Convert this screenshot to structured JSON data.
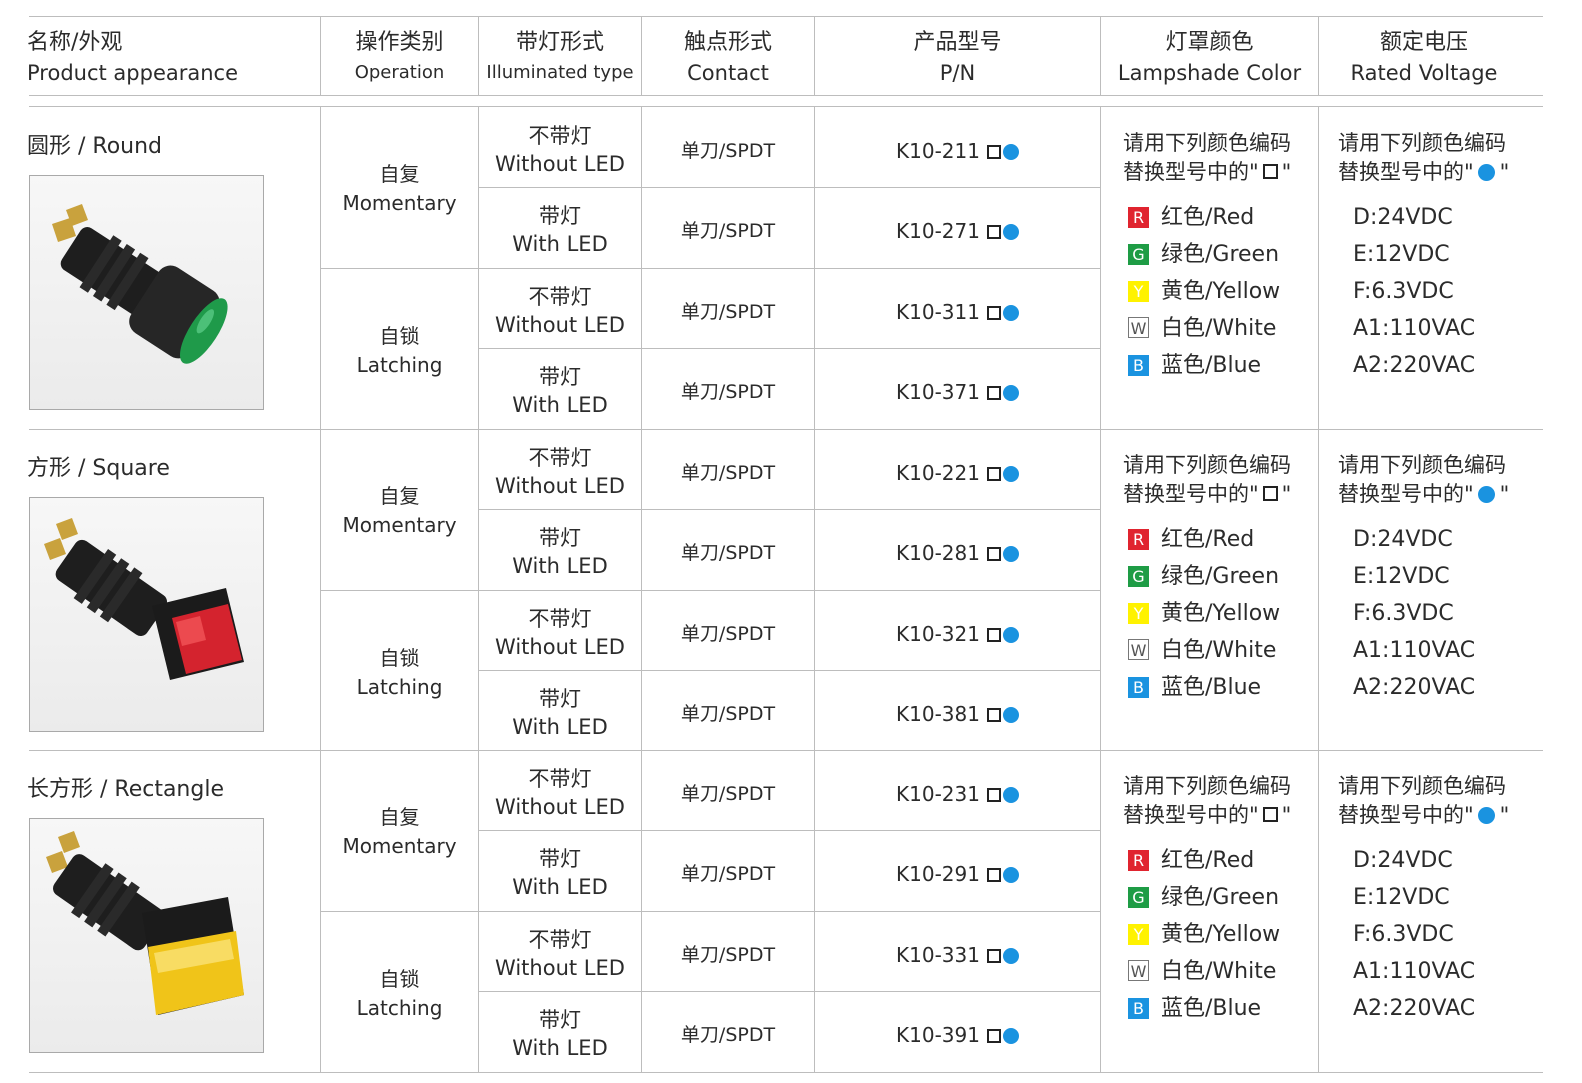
{
  "header": {
    "appearance_cn": "名称/外观",
    "appearance_en": "Product appearance",
    "operation_cn": "操作类别",
    "operation_en": "Operation",
    "illum_cn": "带灯形式",
    "illum_en": "Illuminated type",
    "contact_cn": "触点形式",
    "contact_en": "Contact",
    "pn_cn": "产品型号",
    "pn_en": "P/N",
    "color_cn": "灯罩颜色",
    "color_en": "Lampshade Color",
    "voltage_cn": "额定电压",
    "voltage_en": "Rated Voltage"
  },
  "groups": [
    {
      "shape": "圆形 / Round",
      "photo_icon": "round-green-pushbutton",
      "lens_color": "#1f9a4a",
      "ops": [
        {
          "cn": "自复",
          "en": "Momentary"
        },
        {
          "cn": "自锁",
          "en": "Latching"
        }
      ],
      "rows": [
        {
          "illum_cn": "不带灯",
          "illum_en": "Without LED",
          "contact": "单刀/SPDT",
          "pn": "K10-211"
        },
        {
          "illum_cn": "带灯",
          "illum_en": "With LED",
          "contact": "单刀/SPDT",
          "pn": "K10-271"
        },
        {
          "illum_cn": "不带灯",
          "illum_en": "Without LED",
          "contact": "单刀/SPDT",
          "pn": "K10-311"
        },
        {
          "illum_cn": "带灯",
          "illum_en": "With LED",
          "contact": "单刀/SPDT",
          "pn": "K10-371"
        }
      ]
    },
    {
      "shape": "方形 / Square",
      "photo_icon": "square-red-pushbutton",
      "lens_color": "#d4232e",
      "ops": [
        {
          "cn": "自复",
          "en": "Momentary"
        },
        {
          "cn": "自锁",
          "en": "Latching"
        }
      ],
      "rows": [
        {
          "illum_cn": "不带灯",
          "illum_en": "Without LED",
          "contact": "单刀/SPDT",
          "pn": "K10-221"
        },
        {
          "illum_cn": "带灯",
          "illum_en": "With LED",
          "contact": "单刀/SPDT",
          "pn": "K10-281"
        },
        {
          "illum_cn": "不带灯",
          "illum_en": "Without LED",
          "contact": "单刀/SPDT",
          "pn": "K10-321"
        },
        {
          "illum_cn": "带灯",
          "illum_en": "With LED",
          "contact": "单刀/SPDT",
          "pn": "K10-381"
        }
      ]
    },
    {
      "shape": "长方形 / Rectangle",
      "photo_icon": "rectangle-yellow-pushbutton",
      "lens_color": "#f0c419",
      "ops": [
        {
          "cn": "自复",
          "en": "Momentary"
        },
        {
          "cn": "自锁",
          "en": "Latching"
        }
      ],
      "rows": [
        {
          "illum_cn": "不带灯",
          "illum_en": "Without LED",
          "contact": "单刀/SPDT",
          "pn": "K10-231"
        },
        {
          "illum_cn": "带灯",
          "illum_en": "With LED",
          "contact": "单刀/SPDT",
          "pn": "K10-291"
        },
        {
          "illum_cn": "不带灯",
          "illum_en": "Without LED",
          "contact": "单刀/SPDT",
          "pn": "K10-331"
        },
        {
          "illum_cn": "带灯",
          "illum_en": "With LED",
          "contact": "单刀/SPDT",
          "pn": "K10-391"
        }
      ]
    }
  ],
  "color_note": {
    "line1": "请用下列颜色编码",
    "line2_prefix": "替换型号中的\"",
    "line2_suffix": "\""
  },
  "voltage_note": {
    "line1": "请用下列颜色编码",
    "line2_prefix": "替换型号中的\"",
    "line2_suffix": "\""
  },
  "colors": [
    {
      "code": "R",
      "label": "红色/Red",
      "badge_bg": "#e0242f",
      "badge_fg": "#ffffff"
    },
    {
      "code": "G",
      "label": "绿色/Green",
      "badge_bg": "#1e9c45",
      "badge_fg": "#ffffff"
    },
    {
      "code": "Y",
      "label": "黄色/Yellow",
      "badge_bg": "#fff200",
      "badge_fg": "#ffffff"
    },
    {
      "code": "W",
      "label": "白色/White",
      "badge_bg": "#ffffff",
      "badge_fg": "#555555"
    },
    {
      "code": "B",
      "label": "蓝色/Blue",
      "badge_bg": "#1a93e0",
      "badge_fg": "#ffffff"
    }
  ],
  "voltages": [
    "D:24VDC",
    "E:12VDC",
    "F:6.3VDC",
    "A1:110VAC",
    "A2:220VAC"
  ],
  "accent_blue": "#1a93e0"
}
